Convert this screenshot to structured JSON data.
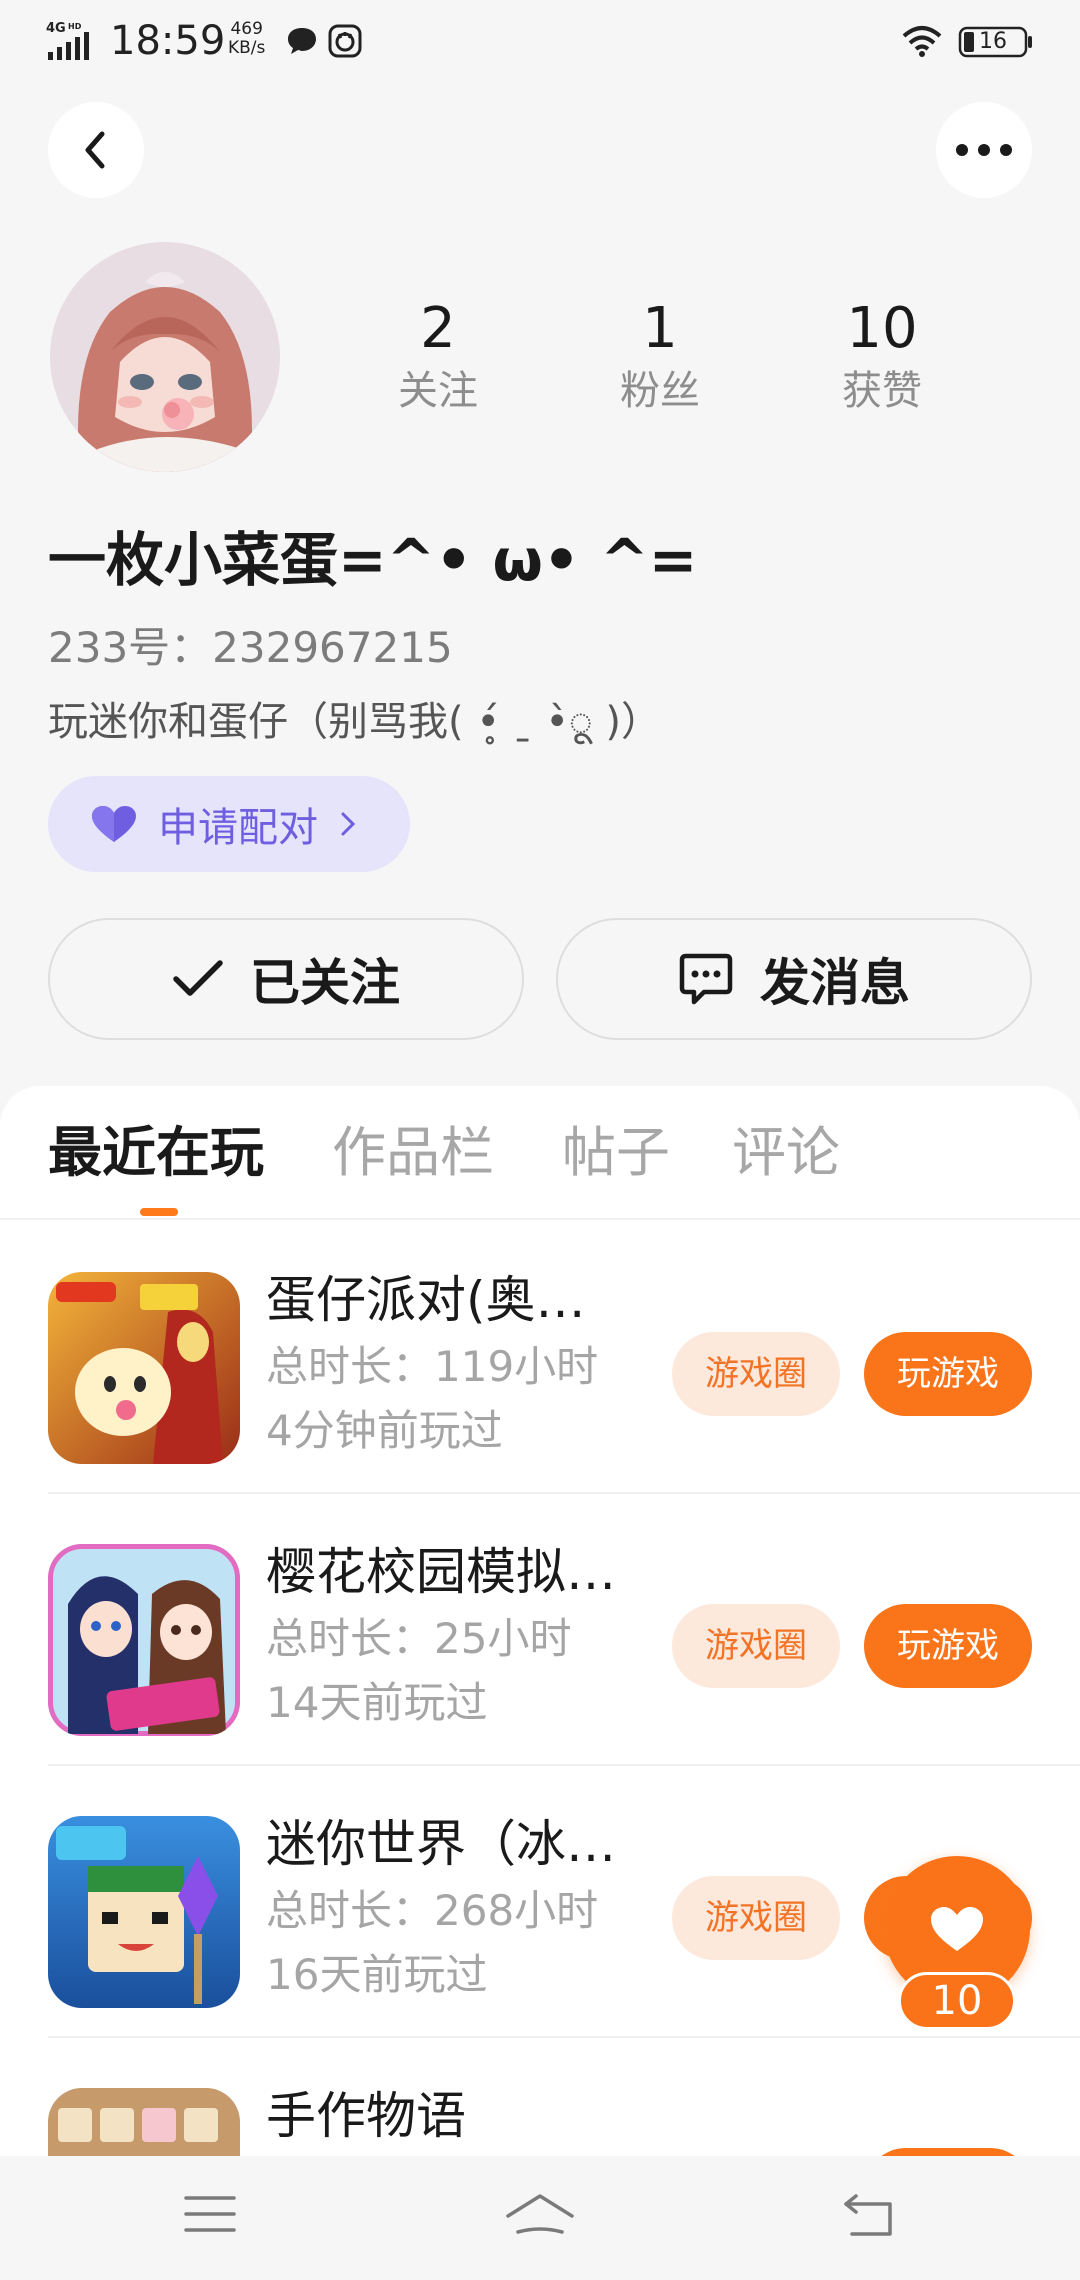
{
  "status_bar": {
    "network": "4G HD",
    "time": "18:59",
    "speed_value": "469",
    "speed_unit": "KB/s",
    "battery": "16",
    "icons": [
      "signal-icon",
      "chat-bubble-icon",
      "app-notification-icon",
      "wifi-icon",
      "battery-icon"
    ]
  },
  "header": {
    "back_icon": "chevron-left-icon",
    "more_icon": "more-dots-icon"
  },
  "profile": {
    "username": "一枚小菜蛋=^• ω• ^=",
    "uid_label": "233号：",
    "uid": "232967215",
    "bio": "玩迷你和蛋仔（别骂我( •̥́ ˍ •̀ू )）",
    "stats": [
      {
        "value": "2",
        "label": "关注"
      },
      {
        "value": "1",
        "label": "粉丝"
      },
      {
        "value": "10",
        "label": "获赞"
      }
    ],
    "pair_button": "申请配对",
    "follow_button": "已关注",
    "message_button": "发消息"
  },
  "tabs": [
    {
      "label": "最近在玩",
      "active": true
    },
    {
      "label": "作品栏",
      "active": false
    },
    {
      "label": "帖子",
      "active": false
    },
    {
      "label": "评论",
      "active": false
    }
  ],
  "games": [
    {
      "title": "蛋仔派对(奥…",
      "duration": "总时长：119小时",
      "last_played": "4分钟前玩过",
      "circle_label": "游戏圈",
      "play_label": "玩游戏"
    },
    {
      "title": "樱花校园模拟…",
      "duration": "总时长：25小时",
      "last_played": "14天前玩过",
      "circle_label": "游戏圈",
      "play_label": "玩游戏"
    },
    {
      "title": "迷你世界（冰…",
      "duration": "总时长：268小时",
      "last_played": "16天前玩过",
      "circle_label": "游戏圈",
      "play_label": "玩游戏"
    },
    {
      "title": "手作物语",
      "duration": "",
      "last_played": "",
      "circle_label": "",
      "play_label": ""
    }
  ],
  "floating_like": {
    "count": "10"
  },
  "colors": {
    "accent": "#fa7419",
    "accent_light": "#fde8dc",
    "pair_bg": "#e6e4fb",
    "pair_text": "#6f5fe0",
    "background": "#f6f6f7"
  }
}
